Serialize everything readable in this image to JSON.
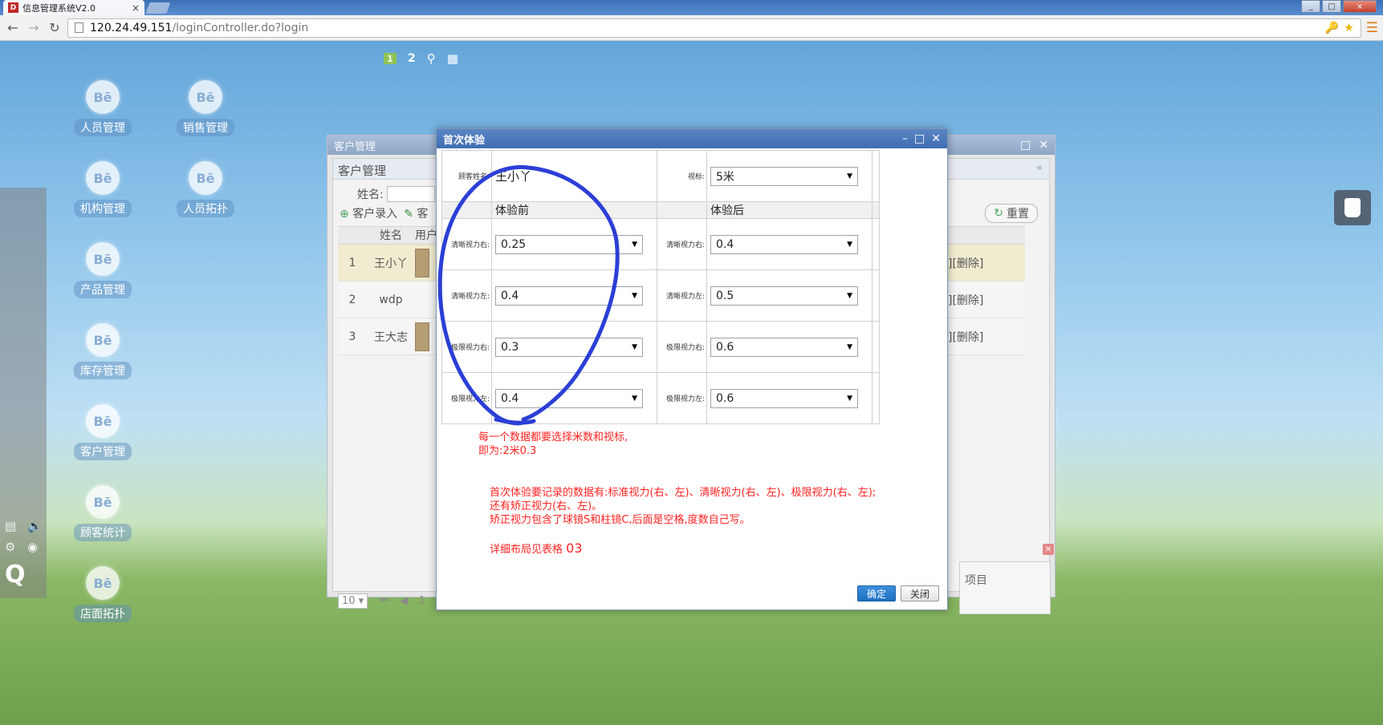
{
  "browser": {
    "tab_title": "信息管理系统V2.0",
    "tab_favicon": "D",
    "tab_close": "×",
    "url_host": "120.24.49.151",
    "url_path": "/loginController.do?login",
    "window_controls": [
      "_",
      "□",
      "×"
    ]
  },
  "desktop": {
    "topbar": {
      "page1": "1",
      "page2": "2"
    },
    "icon_glyph": "Bē",
    "icons": [
      "人员管理",
      "销售管理",
      "机构管理",
      "人员拓扑",
      "产品管理",
      "库存管理",
      "客户管理",
      "顾客统计",
      "店面拓扑"
    ]
  },
  "customer_window": {
    "title": "客户管理",
    "panel_title": "客户管理",
    "search_label": "姓名:",
    "toolbar": [
      "客户录入",
      "客"
    ],
    "reset_label": "重置",
    "columns": {
      "name": "姓名",
      "user": "用户"
    },
    "rows": [
      {
        "num": "1",
        "name": "王小丫",
        "ops": "录][删除]"
      },
      {
        "num": "2",
        "name": "wdp",
        "ops": "录][删除]"
      },
      {
        "num": "3",
        "name": "王大志",
        "ops": "录][删除]"
      }
    ],
    "page_size": "10",
    "page_num": "1",
    "bottom_text": "项目"
  },
  "dialog": {
    "title": "首次体验",
    "customer_name_label": "顾客姓名:",
    "customer_name": "王小丫",
    "chart_label": "视标:",
    "chart_value": "5米",
    "before_header": "体验前",
    "after_header": "体验后",
    "rows": [
      {
        "left_label": "清晰视力右:",
        "left_value": "0.25",
        "right_label": "清晰视力右:",
        "right_value": "0.4"
      },
      {
        "left_label": "清晰视力左:",
        "left_value": "0.4",
        "right_label": "清晰视力左:",
        "right_value": "0.5"
      },
      {
        "left_label": "极限视力右:",
        "left_value": "0.3",
        "right_label": "极限视力右:",
        "right_value": "0.6"
      },
      {
        "left_label": "极限视力左:",
        "left_value": "0.4",
        "right_label": "极限视力左:",
        "right_value": "0.6"
      }
    ],
    "note1": "每一个数据都要选择米数和视标,\n即为:2米0.3",
    "note2": "首次体验要记录的数据有:标准视力(右、左)、清晰视力(右、左)、极限视力(右、左);\n还有矫正视力(右、左)。\n矫正视力包含了球镜S和柱镜C,后面是空格,度数自己写。",
    "note3_prefix": "详细布局见表格 ",
    "note3_number": "03",
    "ok_label": "确定",
    "close_label": "关闭"
  },
  "colors": {
    "annotation_blue": "#2b3fd6",
    "note_red": "#ff2222",
    "title_blue": "#3e6eb2"
  }
}
